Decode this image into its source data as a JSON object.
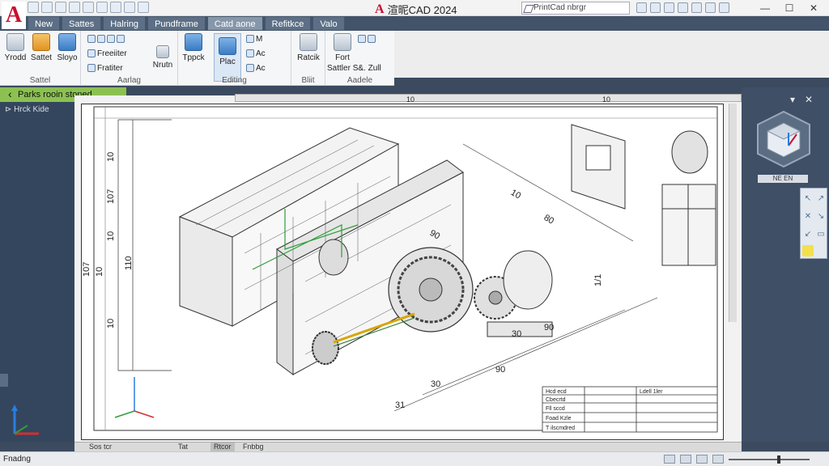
{
  "app": {
    "title": "渲昵CAD 2024",
    "search_placeholder": "PrintCad nbrgr",
    "logo_letter": "A"
  },
  "ribbon_tabs": [
    "New",
    "Sattes",
    "Halring",
    "Pundframe",
    "Catd aone",
    "Refitkce",
    "Valo"
  ],
  "active_tab": 4,
  "ribbon": {
    "group1": {
      "label": "Sattel",
      "buttons": [
        "Yrodd",
        "Sattet",
        "Sloyo"
      ]
    },
    "group2": {
      "label": "Aarlag",
      "items": [
        "Freeiiter",
        "Fratiter",
        "Nrutn"
      ]
    },
    "group3": {
      "label": "Editing",
      "buttons": [
        "Plac",
        "Tppck"
      ],
      "small": [
        "M",
        "Ac",
        "Ac"
      ]
    },
    "group4": {
      "label": "Bliit",
      "buttons": [
        "Ratcik"
      ]
    },
    "group5": {
      "label": "Aadele",
      "buttons": [
        "Fort",
        "Sattler",
        "S&. Zull"
      ]
    }
  },
  "notification": "Parks rooin stoned",
  "left_panel": {
    "item": "Hrck Kide"
  },
  "viewcube": {
    "label": "NE EN",
    "accent": "#c8102e"
  },
  "drawing": {
    "dimensions": {
      "left": [
        "10",
        "107",
        "10",
        "10",
        "107",
        "10",
        "110"
      ],
      "bottom": [
        "30",
        "90",
        "30",
        "90",
        "31",
        "1/1"
      ],
      "top": [
        "10",
        "10"
      ],
      "diagonal": [
        "80",
        "10",
        "90"
      ]
    },
    "title_block": {
      "rows": [
        "Hcd ecd",
        "Cbecrtd",
        "Fll sccd",
        "Foad Kzle",
        "T ilscmdred",
        "Ldell 1ler"
      ]
    }
  },
  "layout_tabs": [
    "Sos tcr",
    "Tat",
    "Rtcor",
    "Fnbbg"
  ],
  "active_layout": 2,
  "status": {
    "left_text": "Fnadng"
  },
  "colors": {
    "accent_green": "#8cc152",
    "panel_dark": "#34465d",
    "tab_active": "#8797ab"
  }
}
